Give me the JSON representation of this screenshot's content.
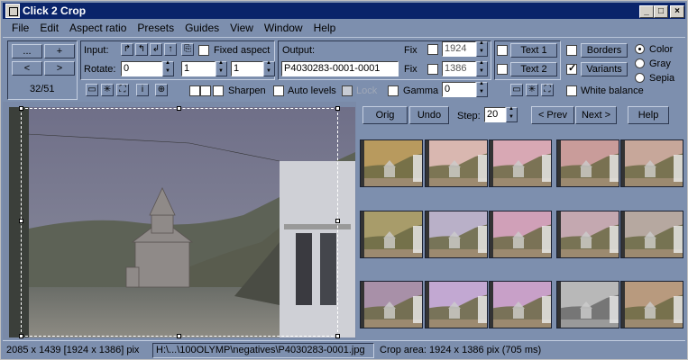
{
  "window": {
    "title": "Click 2 Crop"
  },
  "menu": [
    "File",
    "Edit",
    "Aspect ratio",
    "Presets",
    "Guides",
    "View",
    "Window",
    "Help"
  ],
  "nav": {
    "btn_dots": "...",
    "btn_plus": "+",
    "btn_prev": "<",
    "btn_next": ">",
    "counter": "32/51"
  },
  "input": {
    "label": "Input:",
    "rotate_label": "Rotate:",
    "rotate_value": "0",
    "fixed_aspect_label": "Fixed aspect",
    "aspect_a": "1",
    "aspect_b": "1",
    "sharpen_label": "Sharpen",
    "auto_levels_label": "Auto levels",
    "lock_label": "Lock",
    "gamma_label": "Gamma",
    "gamma_value": "0"
  },
  "output": {
    "label": "Output:",
    "filename": "P4030283-0001-0001",
    "fix_label": "Fix",
    "width": "1924",
    "height": "1386"
  },
  "text": {
    "text1": "Text 1",
    "text2": "Text 2"
  },
  "options": {
    "borders": "Borders",
    "variants": "Variants",
    "white_balance": "White balance",
    "color": "Color",
    "gray": "Gray",
    "sepia": "Sepia"
  },
  "controls": {
    "orig": "Orig",
    "undo": "Undo",
    "step_label": "Step:",
    "step_value": "20",
    "prev": "< Prev",
    "next": "Next >",
    "help": "Help"
  },
  "status": {
    "image_size": "2085 x 1439  [1924 x 1386] pix",
    "path": "H:\\...\\100OLYMP\\negatives\\P4030283-0001.jpg",
    "crop_area": "Crop area: 1924 x 1386 pix (705 ms)"
  },
  "colors": {
    "accent": "#0a246a",
    "panel": "#7d8fae"
  },
  "thumbnails": [
    {
      "tint": "#b89a5e",
      "filter": "none"
    },
    {
      "tint": "#d9b7b0",
      "filter": "none"
    },
    {
      "tint": "#d8a8b4",
      "filter": "none"
    },
    {
      "tint": "#c99c9a",
      "filter": "none"
    },
    {
      "tint": "#c7a79a",
      "filter": "none"
    },
    {
      "tint": "#a89c6a",
      "filter": "none"
    },
    {
      "tint": "#b9b0c8",
      "filter": "none"
    },
    {
      "tint": "#d0a0b8",
      "filter": "none"
    },
    {
      "tint": "#c4a8b0",
      "filter": "none"
    },
    {
      "tint": "#b6a8a0",
      "filter": "none"
    },
    {
      "tint": "#a890a8",
      "filter": "none"
    },
    {
      "tint": "#c2a8d2",
      "filter": "none"
    },
    {
      "tint": "#c8a0c8",
      "filter": "none"
    },
    {
      "tint": "#b8b8b8",
      "filter": "gray"
    },
    {
      "tint": "#b89a7e",
      "filter": "sepia"
    }
  ]
}
